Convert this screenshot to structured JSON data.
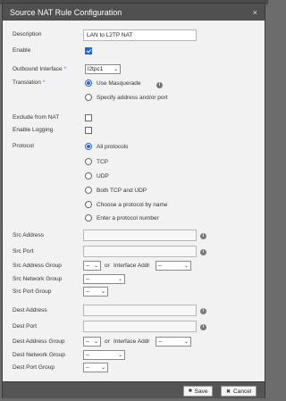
{
  "dialog": {
    "title": "Source NAT Rule Configuration",
    "close_glyph": "×"
  },
  "form": {
    "description": {
      "label": "Description",
      "value": "LAN to L2TP NAT"
    },
    "enable": {
      "label": "Enable",
      "checked": true
    },
    "outbound_interface": {
      "label": "Outbound Interface",
      "required": "*",
      "value": "l2tpc1"
    },
    "translation": {
      "label": "Translation",
      "required": "*",
      "options": [
        {
          "label": "Use Masquerade",
          "selected": true
        },
        {
          "label": "Specify address and/or port",
          "selected": false
        }
      ]
    },
    "exclude_from_nat": {
      "label": "Exclude from NAT",
      "checked": false
    },
    "enable_logging": {
      "label": "Enable Logging",
      "checked": false
    },
    "protocol": {
      "label": "Protocol",
      "options": [
        {
          "label": "All protocols",
          "selected": true
        },
        {
          "label": "TCP",
          "selected": false
        },
        {
          "label": "UDP",
          "selected": false
        },
        {
          "label": "Both TCP and UDP",
          "selected": false
        },
        {
          "label": "Choose a protocol by name",
          "selected": false
        },
        {
          "label": "Enter a protocol number",
          "selected": false
        }
      ]
    },
    "src": {
      "address": {
        "label": "Src Address",
        "value": ""
      },
      "port": {
        "label": "Src Port",
        "value": ""
      },
      "address_group": {
        "label": "Src Address Group",
        "value": "--"
      },
      "or_text": "or",
      "interface_addr": {
        "label": "Interface Addr",
        "value": "--"
      },
      "network_group": {
        "label": "Src Network Group",
        "value": "--"
      },
      "port_group": {
        "label": "Src Port Group",
        "value": "--"
      }
    },
    "dest": {
      "address": {
        "label": "Dest Address",
        "value": ""
      },
      "port": {
        "label": "Dest Port",
        "value": ""
      },
      "address_group": {
        "label": "Dest Address Group",
        "value": "--"
      },
      "or_text": "or",
      "interface_addr": {
        "label": "Interface Addr",
        "value": "--"
      },
      "network_group": {
        "label": "Dest Network Group",
        "value": "--"
      },
      "port_group": {
        "label": "Dest Port Group",
        "value": "--"
      }
    }
  },
  "footer": {
    "save_label": "Save",
    "cancel_label": "Cancel",
    "save_icon": "floppy-disk-icon",
    "cancel_icon": "x-icon"
  },
  "colors": {
    "accent": "#2d64c8",
    "title_bar": "#505050",
    "dialog_bg": "#f2f2f2"
  }
}
